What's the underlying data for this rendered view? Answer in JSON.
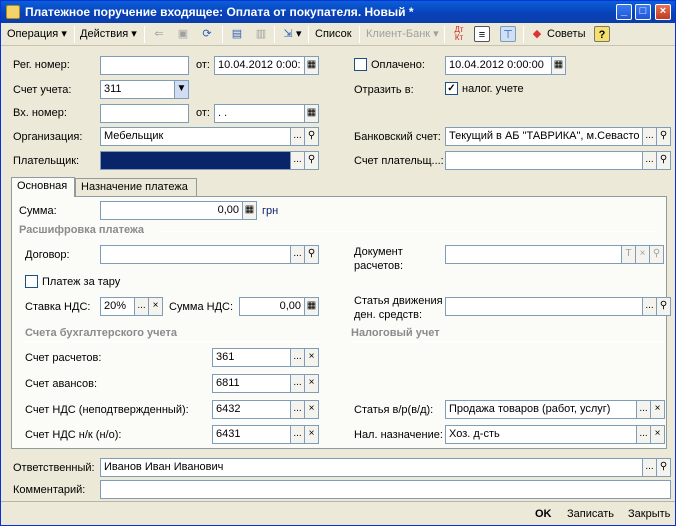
{
  "window": {
    "title": "Платежное поручение входящее: Оплата от покупателя. Новый *",
    "controls": [
      "_",
      "□",
      "×"
    ]
  },
  "toolbar": {
    "operation": "Операция",
    "actions": "Действия",
    "list": "Список",
    "client_bank": "Клиент-Банк",
    "dtkt": "Дт Кт",
    "advice": "Советы",
    "help": "?"
  },
  "header": {
    "reg_number_label": "Рег. номер:",
    "reg_number_value": "",
    "from_label": "от:",
    "reg_date": "10.04.2012  0:00:",
    "paid_label": "Оплачено:",
    "paid_checked": false,
    "paid_date": "10.04.2012 0:00:00",
    "account_label": "Счет учета:",
    "account_value": "311",
    "reflect_label": "Отразить в:",
    "tax_accounting_label": "налог. учете",
    "tax_accounting_checked": true,
    "incoming_number_label": "Вх. номер:",
    "incoming_number_value": "",
    "incoming_from_label": "от:",
    "incoming_date": " .  .",
    "organization_label": "Организация:",
    "organization_value": "Мебельщик",
    "bank_account_label": "Банковский счет:",
    "bank_account_value": "Текущий в АБ \"ТАВРИКА\", м.Севасто",
    "payer_label": "Плательщик:",
    "payer_value": "",
    "payer_account_label": "Счет плательщ...:",
    "payer_account_value": ""
  },
  "tabs": [
    {
      "label": "Основная",
      "active": true
    },
    {
      "label": "Назначение платежа",
      "active": false
    }
  ],
  "main": {
    "sum_label": "Сумма:",
    "sum_value": "0,00",
    "currency": "грн",
    "breakdown_title": "Расшифровка платежа",
    "contract_label": "Договор:",
    "contract_value": "",
    "settlement_doc_label_1": "Документ",
    "settlement_doc_label_2": "расчетов:",
    "settlement_doc_value": "",
    "container_payment_label": "Платеж за тару",
    "container_payment_checked": false,
    "vat_rate_label": "Ставка НДС:",
    "vat_rate_value": "20%",
    "vat_sum_label": "Сумма НДС:",
    "vat_sum_value": "0,00",
    "cash_flow_label_1": "Статья движения",
    "cash_flow_label_2": "ден. средств:",
    "cash_flow_value": "",
    "accounts_title": "Счета бухгалтерского учета",
    "tax_title": "Налоговый учет",
    "settlement_account_label": "Счет расчетов:",
    "settlement_account_value": "361",
    "advance_account_label": "Счет авансов:",
    "advance_account_value": "6811",
    "vat_unconfirmed_label": "Счет НДС (неподтвержденный):",
    "vat_unconfirmed_value": "6432",
    "vat_nk_label": "Счет НДС н/к (н/о):",
    "vat_nk_value": "6431",
    "tax_article_label": "Статья в/р(в/д):",
    "tax_article_value": "Продажа товаров (работ, услуг)",
    "tax_purpose_label": "Нал. назначение:",
    "tax_purpose_value": "Хоз. д-сть"
  },
  "bottom": {
    "responsible_label": "Ответственный:",
    "responsible_value": "Иванов Иван Иванович",
    "comment_label": "Комментарий:",
    "comment_value": ""
  },
  "footer": {
    "ok": "OK",
    "save": "Записать",
    "close": "Закрыть"
  },
  "colors": {
    "title_bar": "#0840b8",
    "selected_field": "#0a246a",
    "section_text": "#8b8b8b"
  }
}
